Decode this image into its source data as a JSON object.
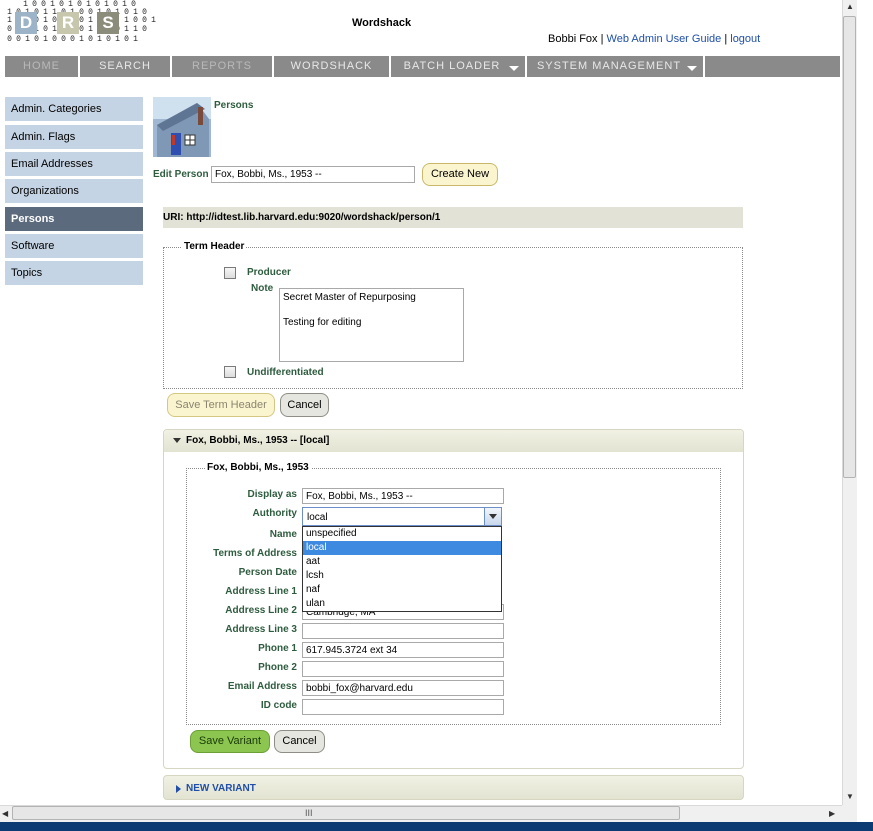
{
  "header": {
    "logo_letters": [
      "D",
      "R",
      "S"
    ],
    "app_title": "Wordshack",
    "user_name": "Bobbi Fox",
    "separator": "|",
    "guide_link": "Web Admin User Guide",
    "logout_link": "logout"
  },
  "nav": [
    {
      "label": "HOME",
      "dim": true
    },
    {
      "label": "SEARCH",
      "dim": false
    },
    {
      "label": "REPORTS",
      "dim": true
    },
    {
      "label": "WORDSHACK",
      "dim": false
    },
    {
      "label": "BATCH LOADER",
      "dim": false,
      "dropdown": true
    },
    {
      "label": "SYSTEM MANAGEMENT",
      "dim": false,
      "dropdown": true
    }
  ],
  "sidebar": {
    "items": [
      {
        "label": "Admin. Categories"
      },
      {
        "label": "Admin. Flags"
      },
      {
        "label": "Email Addresses"
      },
      {
        "label": "Organizations"
      },
      {
        "label": "Persons",
        "active": true
      },
      {
        "label": "Software"
      },
      {
        "label": "Topics"
      }
    ]
  },
  "page": {
    "title": "Persons",
    "edit_label": "Edit Person",
    "edit_value": "Fox, Bobbi, Ms., 1953 --",
    "create_button": "Create New",
    "uri": "URI: http://idtest.lib.harvard.edu:9020/wordshack/person/1"
  },
  "term_header": {
    "legend": "Term Header",
    "producer_label": "Producer",
    "note_label": "Note",
    "note_line1": "Secret Master of Repurposing",
    "note_line2": "Testing for editing",
    "undifferentiated_label": "Undifferentiated",
    "save_button": "Save Term Header",
    "cancel_button": "Cancel"
  },
  "variant": {
    "header": "Fox, Bobbi, Ms., 1953 -- [local]",
    "legend": "Fox, Bobbi, Ms., 1953",
    "labels": {
      "display_as": "Display as",
      "authority": "Authority",
      "name": "Name",
      "terms_of_address": "Terms of Address",
      "person_date": "Person Date",
      "address1": "Address Line 1",
      "address2": "Address Line 2",
      "address3": "Address Line 3",
      "phone1": "Phone 1",
      "phone2": "Phone 2",
      "email": "Email Address",
      "id_code": "ID code"
    },
    "values": {
      "display_as": "Fox, Bobbi, Ms., 1953 --",
      "authority": "local",
      "address2": "Cambridge, MA",
      "address3": "",
      "phone1": "617.945.3724 ext 34",
      "phone2": "",
      "email": "bobbi_fox@harvard.edu",
      "id_code": ""
    },
    "authority_options": [
      "unspecified",
      "local",
      "aat",
      "lcsh",
      "naf",
      "ulan"
    ],
    "save_button": "Save Variant",
    "cancel_button": "Cancel"
  },
  "new_variant": "NEW VARIANT",
  "scroll_grip": "III"
}
